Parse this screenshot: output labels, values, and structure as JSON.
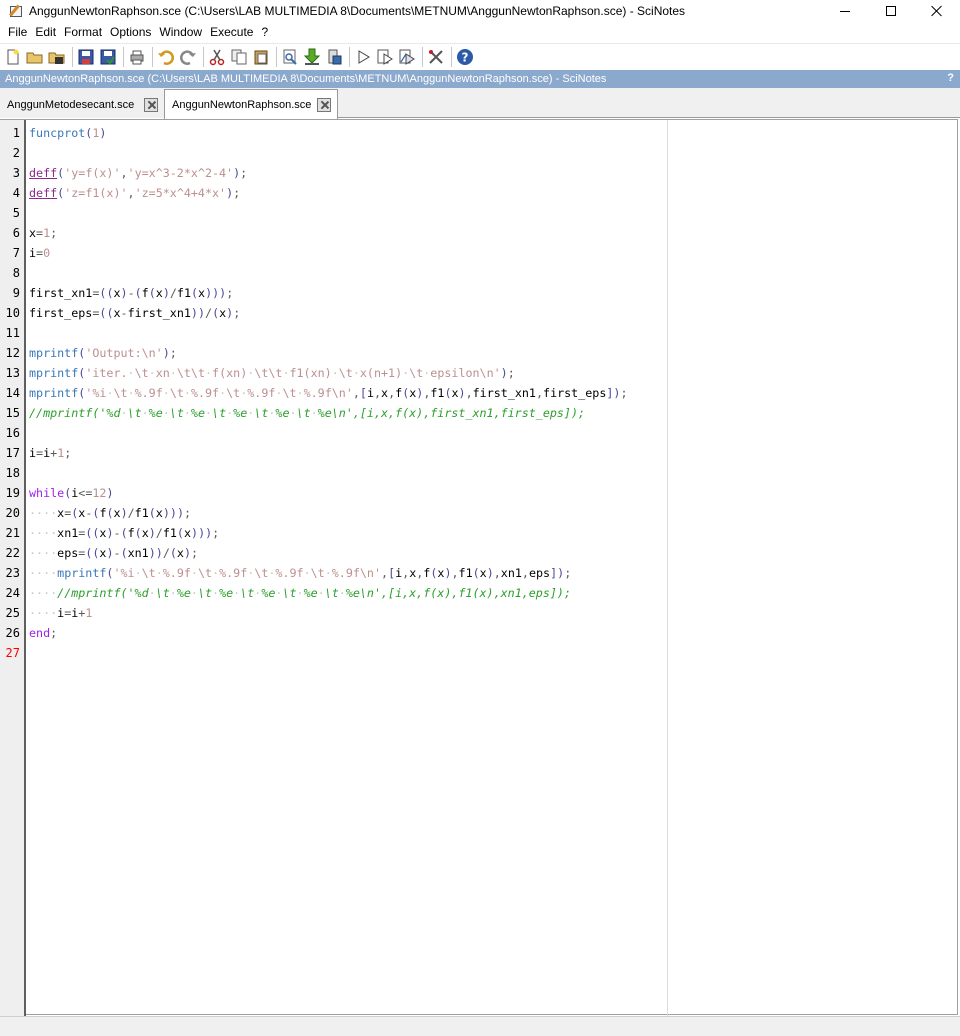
{
  "window": {
    "title": "AnggunNewtonRaphson.sce (C:\\Users\\LAB MULTIMEDIA 8\\Documents\\METNUM\\AnggunNewtonRaphson.sce) - SciNotes"
  },
  "menu": {
    "items": [
      "File",
      "Edit",
      "Format",
      "Options",
      "Window",
      "Execute",
      "?"
    ]
  },
  "toolbar": {
    "buttons": [
      "new-file",
      "open-file",
      "open-recent",
      "save",
      "save-as",
      "print",
      "undo",
      "redo",
      "cut",
      "copy",
      "paste",
      "find",
      "execute-save",
      "execute-selection",
      "run",
      "run-file",
      "run-with-echo",
      "cut-tool",
      "help"
    ]
  },
  "infobar": {
    "text": "AnggunNewtonRaphson.sce (C:\\Users\\LAB MULTIMEDIA 8\\Documents\\METNUM\\AnggunNewtonRaphson.sce) - SciNotes",
    "help": "?"
  },
  "tabs": [
    {
      "label": "AnggunMetodesecant.sce",
      "active": false
    },
    {
      "label": "AnggunNewtonRaphson.sce",
      "active": true
    }
  ],
  "editor": {
    "current_line": "27",
    "line_numbers": [
      "1",
      "2",
      "3",
      "4",
      "5",
      "6",
      "7",
      "8",
      "9",
      "10",
      "11",
      "12",
      "13",
      "14",
      "15",
      "16",
      "17",
      "18",
      "19",
      "20",
      "21",
      "22",
      "23",
      "24",
      "25",
      "26",
      "27"
    ],
    "code_lines": [
      "funcprot(1)",
      "",
      "deff('y=f(x)','y=x^3-2*x^2-4');",
      "deff('z=f1(x)','z=5*x^4+4*x');",
      "",
      "x=1;",
      "i=0",
      "",
      "first_xn1=((x)-(f(x)/f1(x)));",
      "first_eps=((x-first_xn1))/(x);",
      "",
      "mprintf('Output:\\n');",
      "mprintf('iter. \\t xn \\t\\t f(xn) \\t\\t f1(xn) \\t x(n+1) \\t epsilon\\n');",
      "mprintf('%i \\t %.9f \\t %.9f \\t %.9f \\t %.9f\\n',[i,x,f(x),f1(x),first_xn1,first_eps]);",
      "//mprintf('%d \\t %e \\t %e \\t %e \\t %e \\t %e\\n',[i,x,f(x),first_xn1,first_eps]);",
      "",
      "i=i+1;",
      "",
      "while(i<=12)",
      "    x=(x-(f(x)/f1(x)));",
      "    xn1=((x)-(f(x)/f1(x)));",
      "    eps=((x)-(xn1))/(x);",
      "    mprintf('%i \\t %.9f \\t %.9f \\t %.9f \\t %.9f\\n',[i,x,f(x),f1(x),xn1,eps]);",
      "    //mprintf('%d \\t %e \\t %e \\t %e \\t %e \\t %e\\n',[i,x,f(x),f1(x),xn1,eps]);",
      "    i=i+1",
      "end;",
      ""
    ]
  }
}
